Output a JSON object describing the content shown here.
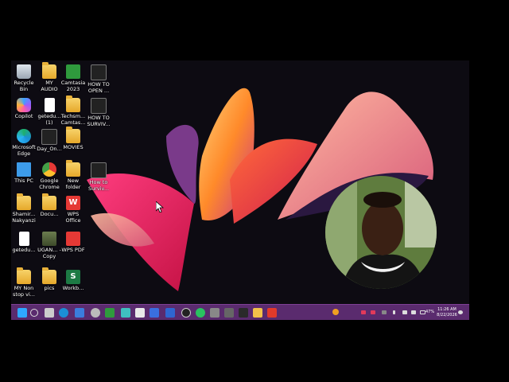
{
  "desktop_icons": [
    {
      "label": "Recycle Bin",
      "icon": "recycle-bin-icon"
    },
    {
      "label": "MY AUDIO",
      "icon": "folder-icon"
    },
    {
      "label": "Camtasia 2023",
      "icon": "camtasia-icon"
    },
    {
      "label": "HOW TO OPEN ...",
      "icon": "video-file-icon"
    },
    {
      "label": "Copilot",
      "icon": "copilot-icon"
    },
    {
      "label": "getedu... (1)",
      "icon": "file-icon"
    },
    {
      "label": "Techsm... Camtas...",
      "icon": "folder-icon"
    },
    {
      "label": "HOW TO SURVIV...",
      "icon": "video-file-icon"
    },
    {
      "label": "Microsoft Edge",
      "icon": "edge-icon"
    },
    {
      "label": "Day_On...",
      "icon": "zip-file-icon"
    },
    {
      "label": "MOVIES",
      "icon": "folder-icon"
    },
    {
      "label": "This PC",
      "icon": "this-pc-icon"
    },
    {
      "label": "Google Chrome",
      "icon": "chrome-icon"
    },
    {
      "label": "New folder",
      "icon": "folder-icon"
    },
    {
      "label": "How to Surviv...",
      "icon": "video-file-icon"
    },
    {
      "label": "Shamir... Nakyanzi",
      "icon": "folder-icon"
    },
    {
      "label": "Docu...",
      "icon": "folder-icon"
    },
    {
      "label": "WPS Office",
      "icon": "wps-office-icon"
    },
    {
      "label": "getedu...",
      "icon": "file-icon"
    },
    {
      "label": "UGAN... - Copy",
      "icon": "image-file-icon"
    },
    {
      "label": "WPS PDF",
      "icon": "wps-pdf-icon"
    },
    {
      "label": "MY Non stop vi...",
      "icon": "folder-icon"
    },
    {
      "label": "pics",
      "icon": "folder-icon"
    },
    {
      "label": "Workb...",
      "icon": "excel-file-icon"
    }
  ],
  "taskbar": {
    "clock_time": "11:26 AM",
    "clock_date": "8/22/2026",
    "battery": "47%"
  },
  "colors": {
    "taskbar": "#5a2b6e",
    "desktop": "#0d0b12"
  }
}
